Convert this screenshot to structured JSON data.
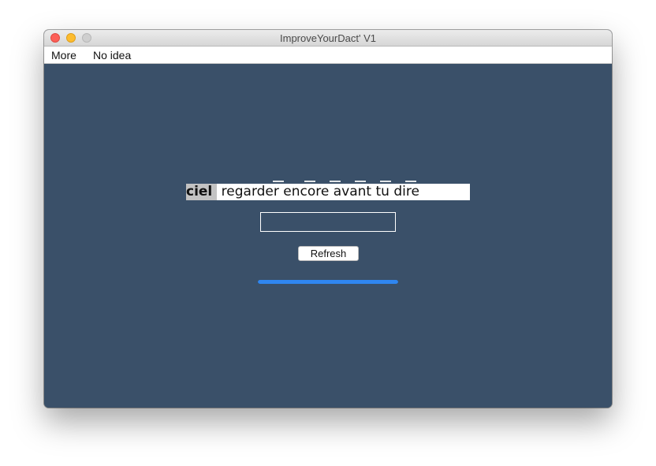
{
  "window": {
    "title": "ImproveYourDact' V1"
  },
  "menu": {
    "items": [
      "More",
      "No idea"
    ]
  },
  "exercise": {
    "current_word": "ciel",
    "remaining_text": "regarder encore avant tu dire",
    "answer_value": "",
    "refresh_label": "Refresh",
    "progress_fraction": 1.0
  },
  "colors": {
    "background": "#3a5069",
    "progress_fill": "#2f86f0",
    "highlight": "#c3c3c3"
  }
}
